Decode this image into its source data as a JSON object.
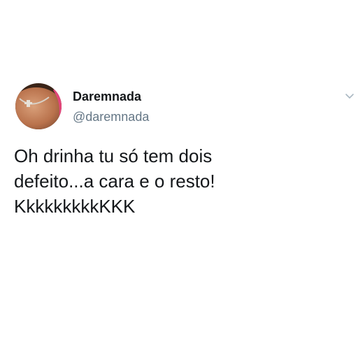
{
  "tweet": {
    "author": {
      "display_name": "Daremnada",
      "handle": "@daremnada",
      "avatar_icon": "profile-photo"
    },
    "menu_icon": "chevron-down-icon",
    "text_lines": [
      "Oh drinha tu só tem dois",
      "defeito...a cara e o resto!",
      "KkkkkkkkkKKK"
    ]
  }
}
